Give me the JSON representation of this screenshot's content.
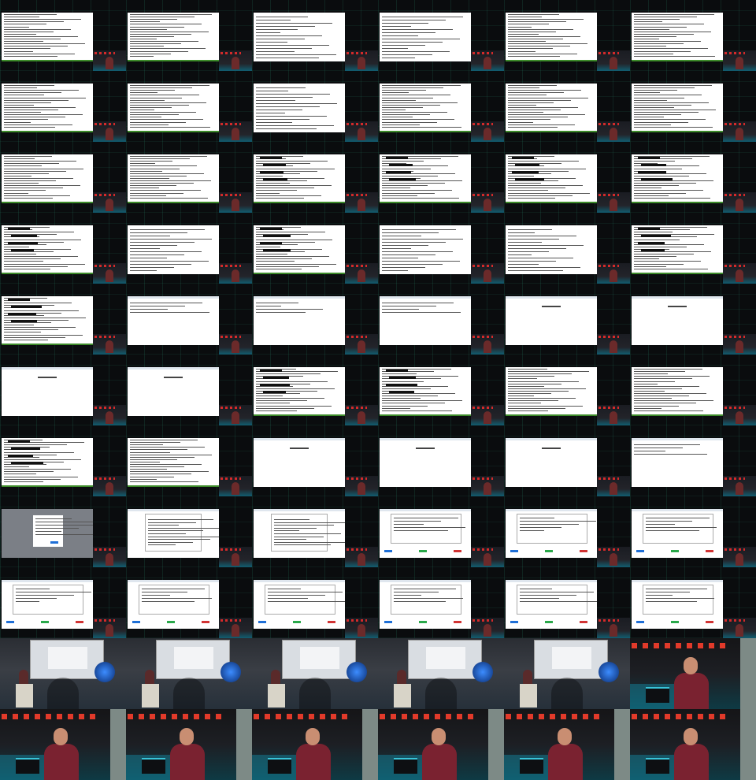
{
  "sheet": {
    "columns": 6,
    "rows": 11,
    "rows_layout": [
      [
        "terminal",
        "terminal",
        "document",
        "document",
        "terminal",
        "terminal"
      ],
      [
        "terminal",
        "terminal",
        "document",
        "terminal",
        "terminal",
        "terminal"
      ],
      [
        "terminal",
        "terminal",
        "terminal-redacted",
        "terminal-redacted",
        "terminal-redacted",
        "terminal-redacted"
      ],
      [
        "terminal-redacted",
        "document",
        "terminal-redacted",
        "document",
        "document",
        "terminal-redacted"
      ],
      [
        "terminal-redacted",
        "browser",
        "browser",
        "browser",
        "blank-page",
        "blank-page"
      ],
      [
        "blank-page",
        "blank-page",
        "terminal-redacted",
        "terminal-redacted",
        "terminal",
        "terminal"
      ],
      [
        "terminal-redacted",
        "terminal",
        "blank-page",
        "blank-page",
        "blank-page",
        "browser"
      ],
      [
        "dialog",
        "article",
        "article",
        "voting",
        "voting",
        "voting"
      ],
      [
        "voting",
        "voting",
        "voting",
        "voting",
        "voting",
        "voting"
      ],
      [
        "stage",
        "stage",
        "stage",
        "stage",
        "stage",
        "speaker"
      ],
      [
        "speaker",
        "speaker",
        "speaker",
        "speaker",
        "speaker",
        "speaker"
      ]
    ]
  },
  "colors": {
    "background": "#050607",
    "screen": "#ffffff",
    "status_bar": "#3d8b2a",
    "button_blue": "#1f6fd6",
    "button_green": "#2aa84a",
    "button_red": "#d13434",
    "stage_light": "#d42a2a",
    "stage_cyan": "#14aac8",
    "shirt": "#7a2230"
  }
}
